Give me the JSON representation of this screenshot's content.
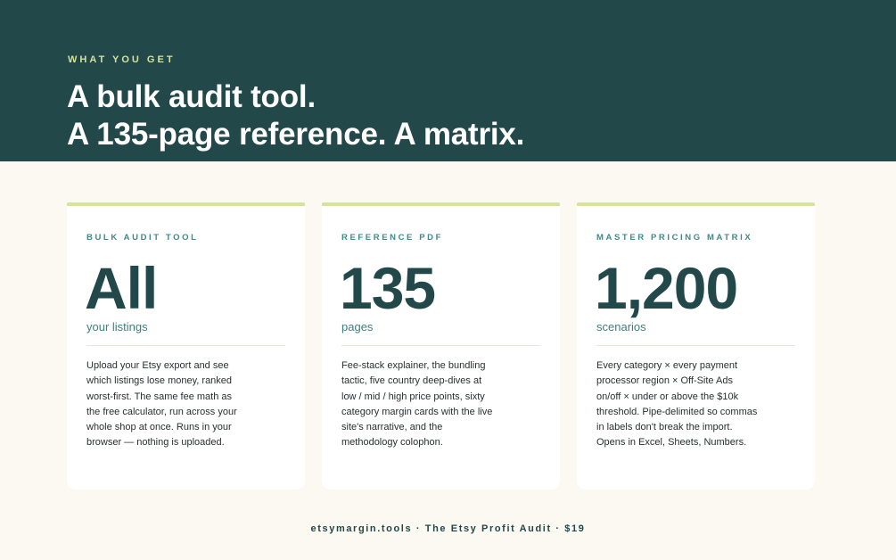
{
  "hero": {
    "eyebrow": "WHAT YOU GET",
    "headline_line1": "A bulk audit tool.",
    "headline_line2": "A 135-page reference. A matrix."
  },
  "cards": [
    {
      "label": "BULK AUDIT TOOL",
      "figure": "All",
      "unit": "your listings",
      "body": [
        "Upload your Etsy export and see",
        "which listings lose money, ranked",
        "worst-first. The same fee math as",
        "the free calculator, run across your",
        "whole shop at once. Runs in your",
        "browser — nothing is uploaded."
      ]
    },
    {
      "label": "REFERENCE PDF",
      "figure": "135",
      "unit": "pages",
      "body": [
        "Fee-stack explainer, the bundling",
        "tactic, five country deep-dives at",
        "low / mid / high price points, sixty",
        "category margin cards with the live",
        "site's narrative, and the",
        "methodology colophon."
      ]
    },
    {
      "label": "MASTER PRICING MATRIX",
      "figure": "1,200",
      "unit": "scenarios",
      "body": [
        "Every category × every payment",
        "processor region × Off-Site Ads",
        "on/off × under or above the $10k",
        "threshold. Pipe-delimited so commas",
        "in labels don't break the import.",
        "Opens in Excel, Sheets, Numbers."
      ]
    }
  ],
  "footer": {
    "text": "etsymargin.tools · The Etsy Profit Audit · $19"
  },
  "colors": {
    "hero_bg": "#22484a",
    "accent": "#d6e49a",
    "label": "#3f8a8b",
    "page_bg": "#fbf9f1"
  }
}
